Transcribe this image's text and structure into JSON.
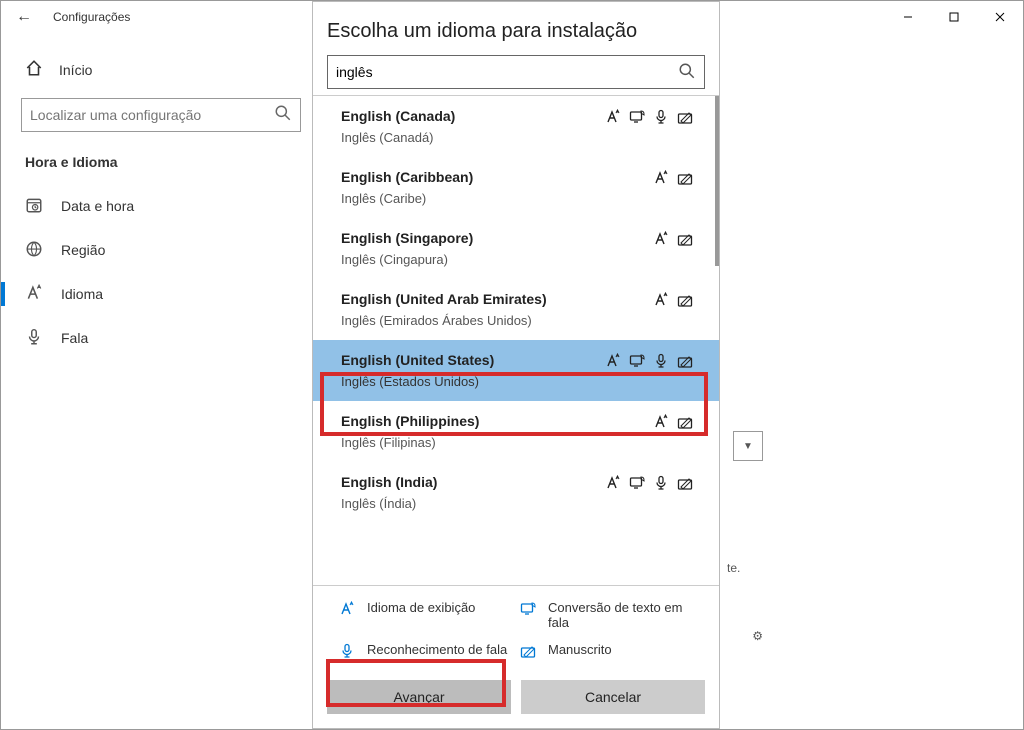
{
  "window": {
    "title": "Configurações"
  },
  "sidebar": {
    "home": "Início",
    "search_placeholder": "Localizar uma configuração",
    "section": "Hora e Idioma",
    "items": [
      {
        "label": "Data e hora"
      },
      {
        "label": "Região"
      },
      {
        "label": "Idioma"
      },
      {
        "label": "Fala"
      }
    ]
  },
  "misc": {
    "truncated": "te."
  },
  "dialog": {
    "title": "Escolha um idioma para instalação",
    "search_value": "inglês",
    "languages": [
      {
        "en": "English (Canada)",
        "loc": "Inglês (Canadá)",
        "caps": [
          "display",
          "tts",
          "speech",
          "ink"
        ],
        "selected": false
      },
      {
        "en": "English (Caribbean)",
        "loc": "Inglês (Caribe)",
        "caps": [
          "display",
          "ink"
        ],
        "selected": false
      },
      {
        "en": "English (Singapore)",
        "loc": "Inglês (Cingapura)",
        "caps": [
          "display",
          "ink"
        ],
        "selected": false
      },
      {
        "en": "English (United Arab Emirates)",
        "loc": "Inglês (Emirados Árabes Unidos)",
        "caps": [
          "display",
          "ink"
        ],
        "selected": false
      },
      {
        "en": "English (United States)",
        "loc": "Inglês (Estados Unidos)",
        "caps": [
          "display",
          "tts",
          "speech",
          "ink"
        ],
        "selected": true
      },
      {
        "en": "English (Philippines)",
        "loc": "Inglês (Filipinas)",
        "caps": [
          "display",
          "ink"
        ],
        "selected": false
      },
      {
        "en": "English (India)",
        "loc": "Inglês (Índia)",
        "caps": [
          "display",
          "tts",
          "speech",
          "ink"
        ],
        "selected": false
      }
    ],
    "legend": {
      "display": "Idioma de exibição",
      "tts": "Conversão de texto em fala",
      "speech": "Reconhecimento de fala",
      "ink": "Manuscrito"
    },
    "buttons": {
      "next": "Avançar",
      "cancel": "Cancelar"
    }
  }
}
